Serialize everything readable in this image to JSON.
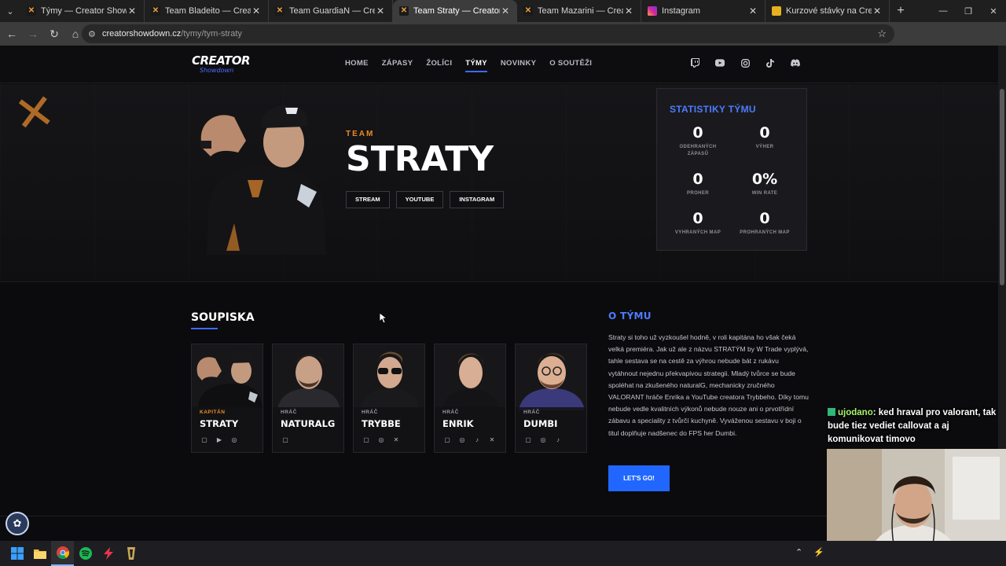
{
  "browser": {
    "tabs": [
      {
        "title": "Týmy — Creator Showdown",
        "icon": "creator-favicon"
      },
      {
        "title": "Team Bladeito — Creator Show",
        "icon": "creator-favicon"
      },
      {
        "title": "Team GuardiaN — Creator Sho",
        "icon": "creator-favicon"
      },
      {
        "title": "Team Straty — Creator Showdo",
        "icon": "creator-favicon",
        "active": true
      },
      {
        "title": "Team Mazarini — Creator Show",
        "icon": "creator-favicon"
      },
      {
        "title": "Instagram",
        "icon": "instagram-favicon"
      },
      {
        "title": "Kurzové stávky na Creator Sho",
        "icon": "betting-favicon"
      }
    ],
    "url_host": "creatorshowdown.cz",
    "url_path": "/tymy/tym-straty"
  },
  "nav": {
    "logo_line1": "CREATOR",
    "logo_line2": "Showdown",
    "items": [
      "HOME",
      "ZÁPASY",
      "ŽOLÍCI",
      "TÝMY",
      "NOVINKY",
      "O SOUTĚŽI"
    ],
    "active_index": 3,
    "socials": [
      "twitch-icon",
      "youtube-icon",
      "instagram-icon",
      "tiktok-icon",
      "discord-icon"
    ]
  },
  "hero": {
    "label": "TEAM",
    "team_name": "STRATY",
    "links": [
      "STREAM",
      "YOUTUBE",
      "INSTAGRAM"
    ]
  },
  "stats": {
    "title": "STATISTIKY TÝMU",
    "items": [
      {
        "value": "0",
        "label": "ODEHRANÝCH ZÁPASŮ"
      },
      {
        "value": "0",
        "label": "VÝHER"
      },
      {
        "value": "0",
        "label": "PROHER"
      },
      {
        "value": "0%",
        "label": "WIN RATE"
      },
      {
        "value": "0",
        "label": "VYHRANÝCH MAP"
      },
      {
        "value": "0",
        "label": "PROHRANÝCH MAP"
      }
    ]
  },
  "roster": {
    "title": "SOUPISKA",
    "players": [
      {
        "role": "KAPITÁN",
        "name": "STRATY",
        "icons": [
          "twitch-icon",
          "youtube-icon",
          "instagram-icon"
        ]
      },
      {
        "role": "HRÁČ",
        "name": "NATURALG",
        "icons": [
          "twitch-icon"
        ]
      },
      {
        "role": "HRÁČ",
        "name": "TRYBBE",
        "icons": [
          "twitch-icon",
          "instagram-icon",
          "x-icon"
        ]
      },
      {
        "role": "HRÁČ",
        "name": "ENRIK",
        "icons": [
          "twitch-icon",
          "instagram-icon",
          "tiktok-icon",
          "x-icon"
        ]
      },
      {
        "role": "HRÁČ",
        "name": "DUMBI",
        "icons": [
          "twitch-icon",
          "instagram-icon",
          "tiktok-icon"
        ]
      }
    ]
  },
  "about": {
    "title": "O TÝMU",
    "text": "Straty si toho už vyzkoušel hodně, v roli kapitána ho však čeká velká premiéra. Jak už ale z názvu STRATÝM by W Trade vyplývá, tahle sestava se na cestě za výhrou nebude bát z rukávu vytáhnout nejednu překvapivou strategii. Mladý tvůrce se bude spoléhat na zkušeného naturalG, mechanicky zručného VALORANT hráče Enrika a YouTube creatora Trybbeho. Díky tomu nebude vedle kvalitních výkonů nebude nouze ani o prvotřídní zábavu a speciality z tvůrčí kuchyně. Vyváženou sestavu v boji o titul doplňuje nadšenec do FPS her Dumbi.",
    "button": "LET'S GO!"
  },
  "stream_chat": {
    "user": "ujodano",
    "message": ": ked hraval pro valorant, tak bude tiez vediet callovat a aj komunikovat timovo"
  },
  "colors": {
    "accent_blue": "#3d6bff",
    "accent_orange": "#f08a24",
    "background": "#0b0b0d"
  }
}
